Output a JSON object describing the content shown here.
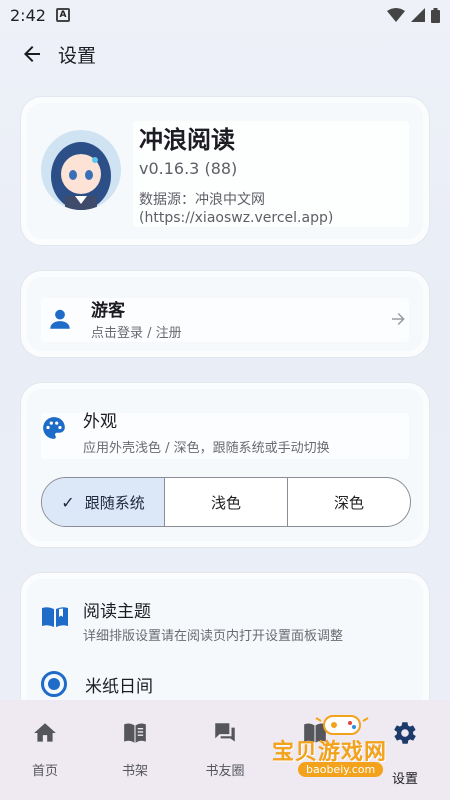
{
  "status_bar": {
    "time": "2:42",
    "notif_letter": "A"
  },
  "app_bar": {
    "title": "设置"
  },
  "about": {
    "app_name": "冲浪阅读",
    "version": "v0.16.3 (88)",
    "source": "数据源：冲浪中文网",
    "url": "(https://xiaoswz.vercel.app)"
  },
  "user": {
    "name": "游客",
    "hint": "点击登录 / 注册"
  },
  "appearance": {
    "title": "外观",
    "subtitle": "应用外壳浅色 / 深色，跟随系统或手动切换",
    "options": [
      "跟随系统",
      "浅色",
      "深色"
    ],
    "selected": "跟随系统"
  },
  "theme": {
    "title": "阅读主题",
    "subtitle": "详细排版设置请在阅读页内打开设置面板调整",
    "selected_option": "米纸日间"
  },
  "bottom_nav": {
    "items": [
      "首页",
      "书架",
      "书友圈",
      "书单",
      "设置"
    ],
    "active": "设置"
  },
  "watermark": {
    "text": "宝贝游戏网",
    "url": "baobeiy.com"
  },
  "colors": {
    "accent": "#1e6cc8",
    "segment_selected": "#dce7f7",
    "nav_bg": "#efeaf2"
  }
}
